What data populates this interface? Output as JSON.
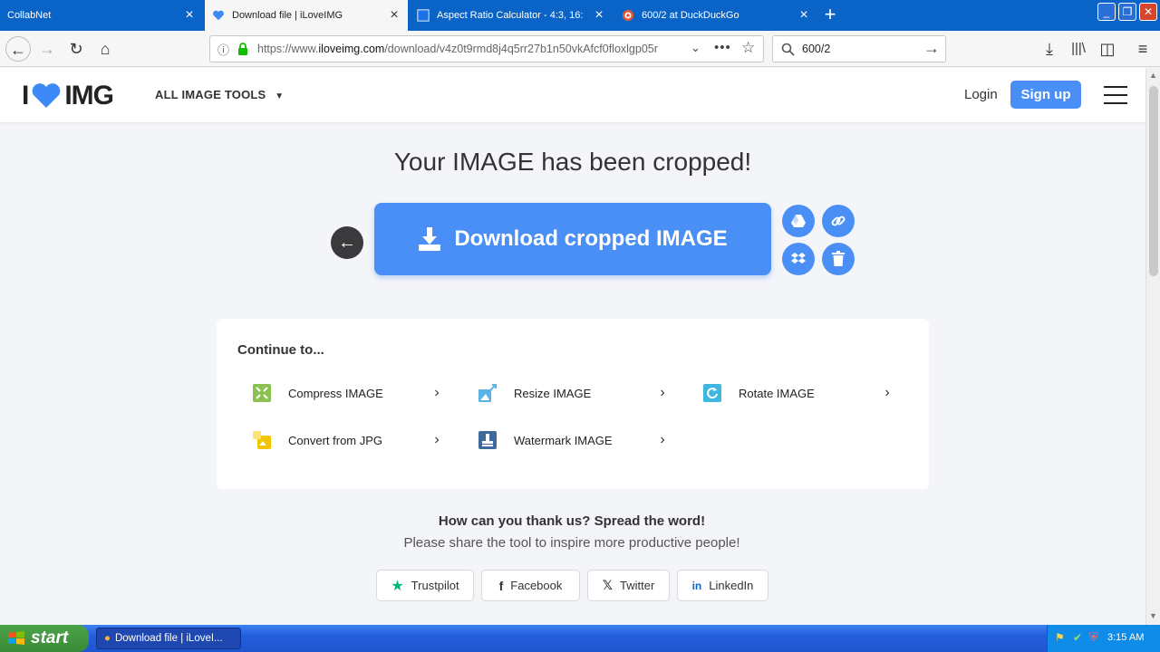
{
  "browser": {
    "tabs": [
      {
        "title": "CollabNet",
        "active": false
      },
      {
        "title": "Download file | iLoveIMG",
        "active": true
      },
      {
        "title": "Aspect Ratio Calculator - 4:3, 16:",
        "active": false
      },
      {
        "title": "600/2 at DuckDuckGo",
        "active": false
      }
    ],
    "new_tab_glyph": "+",
    "close_glyph": "×",
    "url_prefix": "https://www.",
    "url_domain": "iloveimg.com",
    "url_path": "/download/v4z0t9rmd8j4q5rr27b1n50vkAfcf0floxlgp05r",
    "search_query": "600/2"
  },
  "site": {
    "logo_left": "I",
    "logo_right": "IMG",
    "tools_menu": "ALL IMAGE TOOLS",
    "login": "Login",
    "signup": "Sign up"
  },
  "main": {
    "headline": "Your IMAGE has been cropped!",
    "download_label": "Download cropped IMAGE"
  },
  "continue": {
    "title": "Continue to...",
    "tools": [
      {
        "label": "Compress IMAGE",
        "icon": "compress-icon",
        "color": "#8cc152"
      },
      {
        "label": "Resize IMAGE",
        "icon": "resize-icon",
        "color": "#5ab3e6"
      },
      {
        "label": "Rotate IMAGE",
        "icon": "rotate-icon",
        "color": "#3fb6e0"
      },
      {
        "label": "Convert from JPG",
        "icon": "convert-icon",
        "color": "#f2c500"
      },
      {
        "label": "Watermark IMAGE",
        "icon": "watermark-icon",
        "color": "#3d6c9c"
      }
    ]
  },
  "share": {
    "title": "How can you thank us? Spread the word!",
    "subtitle": "Please share the tool to inspire more productive people!",
    "buttons": [
      {
        "label": "Trustpilot",
        "icon": "star-icon"
      },
      {
        "label": "Facebook",
        "icon": "facebook-icon"
      },
      {
        "label": "Twitter",
        "icon": "x-icon"
      },
      {
        "label": "LinkedIn",
        "icon": "linkedin-icon"
      }
    ]
  },
  "taskbar": {
    "start": "start",
    "task_item": "Download file | iLoveI...",
    "clock": "3:15 AM"
  },
  "colors": {
    "brand_blue": "#4a8ff5",
    "heart_blue": "#3d8af7",
    "xp_taskbar": "#245edb",
    "firefox_tabstrip": "#0a63c7"
  }
}
